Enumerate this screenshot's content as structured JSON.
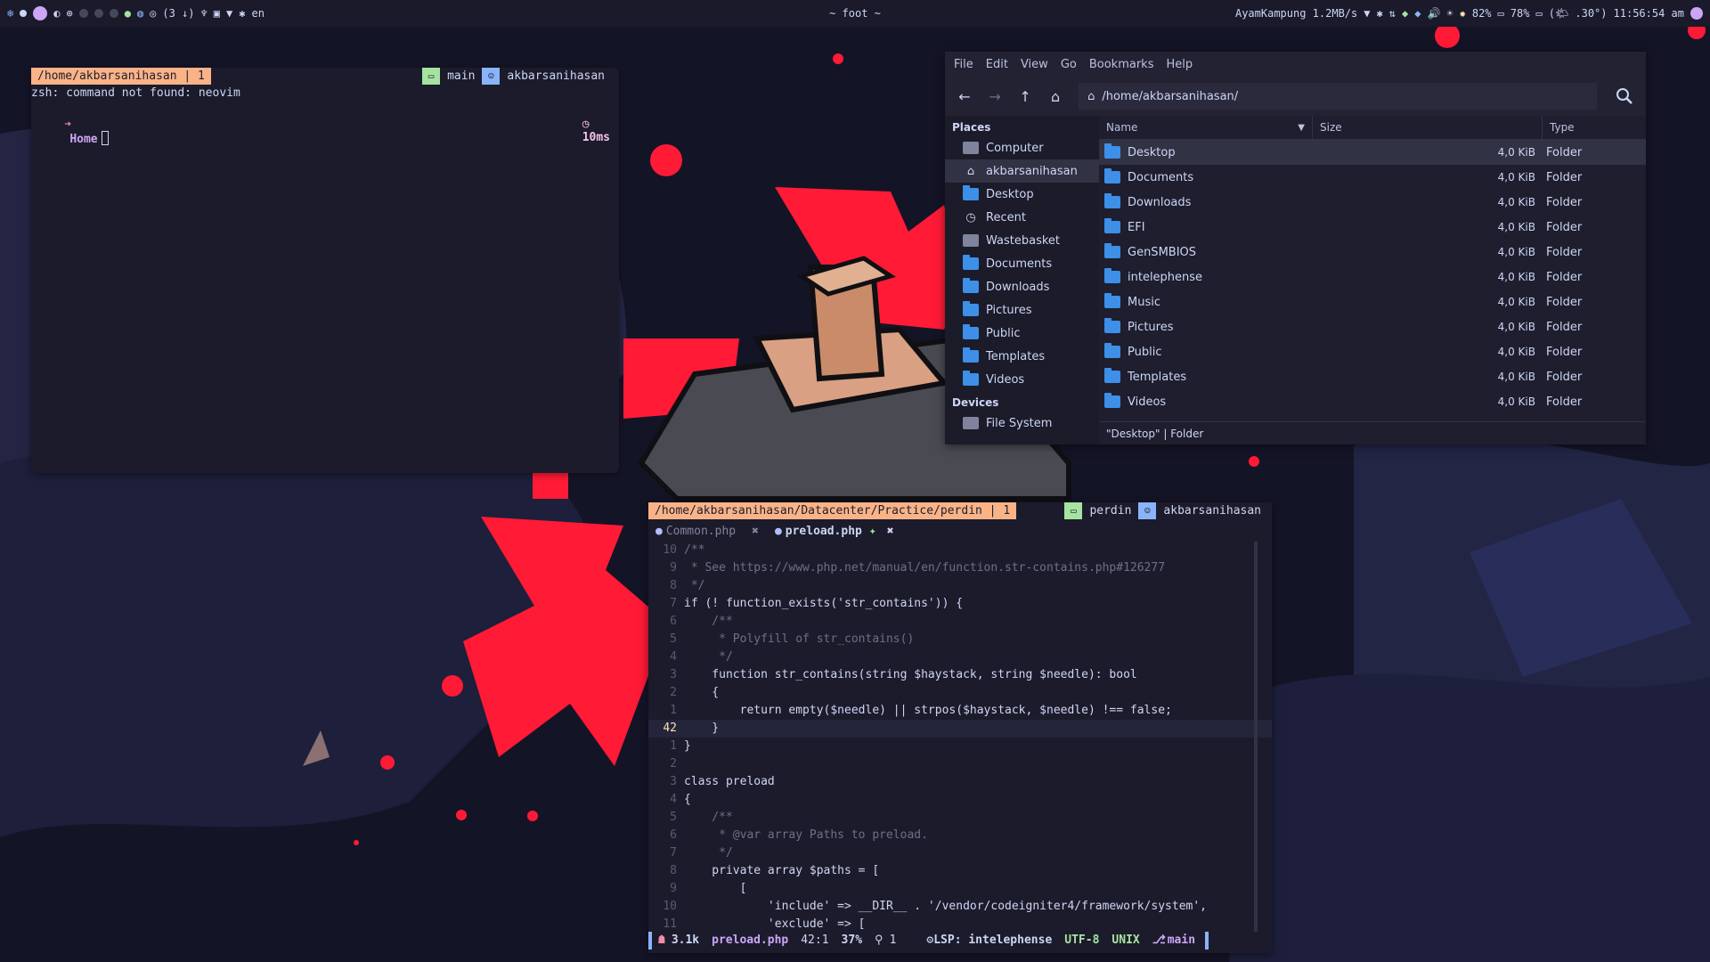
{
  "topbar": {
    "keyboard_layout": "en",
    "window_title": "~ foot ~",
    "network": "AyamKampung 1.2MB/s",
    "battery1": "82%",
    "battery2": "78%",
    "weather": "(🌤 .30°)",
    "clock": "11:56:54 am",
    "workspace_counter": "(3 ↓)"
  },
  "terminal1": {
    "path": "/home/akbarsanihasan | 1",
    "branch": "main",
    "user": "akbarsanihasan",
    "error_line": "zsh: command not found: neovim",
    "prompt_dir": "Home",
    "timing": "10ms"
  },
  "filemanager": {
    "menu": [
      "File",
      "Edit",
      "View",
      "Go",
      "Bookmarks",
      "Help"
    ],
    "location": "/home/akbarsanihasan/",
    "places_header": "Places",
    "devices_header": "Devices",
    "places": [
      {
        "label": "Computer",
        "icon": "computer-icon"
      },
      {
        "label": "akbarsanihasan",
        "icon": "home-icon"
      },
      {
        "label": "Desktop",
        "icon": "folder-icon"
      },
      {
        "label": "Recent",
        "icon": "clock-icon"
      },
      {
        "label": "Wastebasket",
        "icon": "trash-icon"
      },
      {
        "label": "Documents",
        "icon": "folder-icon"
      },
      {
        "label": "Downloads",
        "icon": "folder-icon"
      },
      {
        "label": "Pictures",
        "icon": "folder-icon"
      },
      {
        "label": "Public",
        "icon": "folder-icon"
      },
      {
        "label": "Templates",
        "icon": "folder-icon"
      },
      {
        "label": "Videos",
        "icon": "folder-icon"
      }
    ],
    "devices": [
      {
        "label": "File System",
        "icon": "disk-icon"
      }
    ],
    "columns": {
      "name": "Name",
      "size": "Size",
      "type": "Type"
    },
    "files": [
      {
        "name": "Desktop",
        "size": "4,0 KiB",
        "type": "Folder"
      },
      {
        "name": "Documents",
        "size": "4,0 KiB",
        "type": "Folder"
      },
      {
        "name": "Downloads",
        "size": "4,0 KiB",
        "type": "Folder"
      },
      {
        "name": "EFI",
        "size": "4,0 KiB",
        "type": "Folder"
      },
      {
        "name": "GenSMBIOS",
        "size": "4,0 KiB",
        "type": "Folder"
      },
      {
        "name": "intelephense",
        "size": "4,0 KiB",
        "type": "Folder"
      },
      {
        "name": "Music",
        "size": "4,0 KiB",
        "type": "Folder"
      },
      {
        "name": "Pictures",
        "size": "4,0 KiB",
        "type": "Folder"
      },
      {
        "name": "Public",
        "size": "4,0 KiB",
        "type": "Folder"
      },
      {
        "name": "Templates",
        "size": "4,0 KiB",
        "type": "Folder"
      },
      {
        "name": "Videos",
        "size": "4,0 KiB",
        "type": "Folder"
      }
    ],
    "status": "\"Desktop\" | Folder"
  },
  "editor": {
    "path": "/home/akbarsanihasan/Datacenter/Practice/perdin | 1",
    "branch": "perdin",
    "user": "akbarsanihasan",
    "tabs": [
      {
        "label": "Common.php",
        "active": false
      },
      {
        "label": "preload.php",
        "active": true
      }
    ],
    "lines": [
      {
        "n": "10",
        "text": "/**",
        "cls": "c-com"
      },
      {
        "n": "9",
        "text": " * See https://www.php.net/manual/en/function.str-contains.php#126277",
        "cls": "c-com"
      },
      {
        "n": "8",
        "text": " */",
        "cls": "c-com"
      },
      {
        "n": "7",
        "text": "if (! function_exists('str_contains')) {",
        "cls": "ct"
      },
      {
        "n": "6",
        "text": "    /**",
        "cls": "c-com"
      },
      {
        "n": "5",
        "text": "     * Polyfill of str_contains()",
        "cls": "c-com"
      },
      {
        "n": "4",
        "text": "     */",
        "cls": "c-com"
      },
      {
        "n": "3",
        "text": "    function str_contains(string $haystack, string $needle): bool",
        "cls": "ct"
      },
      {
        "n": "2",
        "text": "    {",
        "cls": "ct"
      },
      {
        "n": "1",
        "text": "        return empty($needle) || strpos($haystack, $needle) !== false;",
        "cls": "ct"
      },
      {
        "n": "42",
        "text": "    }",
        "cls": "ct",
        "current": true
      },
      {
        "n": "1",
        "text": "}",
        "cls": "ct"
      },
      {
        "n": "2",
        "text": "",
        "cls": "ct"
      },
      {
        "n": "3",
        "text": "class preload",
        "cls": "ct"
      },
      {
        "n": "4",
        "text": "{",
        "cls": "ct"
      },
      {
        "n": "5",
        "text": "    /**",
        "cls": "c-com"
      },
      {
        "n": "6",
        "text": "     * @var array Paths to preload.",
        "cls": "c-com"
      },
      {
        "n": "7",
        "text": "     */",
        "cls": "c-com"
      },
      {
        "n": "8",
        "text": "    private array $paths = [",
        "cls": "ct"
      },
      {
        "n": "9",
        "text": "        [",
        "cls": "ct"
      },
      {
        "n": "10",
        "text": "            'include' => __DIR__ . '/vendor/codeigniter4/framework/system',",
        "cls": "ct"
      },
      {
        "n": "11",
        "text": "            'exclude' => [",
        "cls": "ct"
      }
    ],
    "statusline": {
      "size": "3.1k",
      "file": "preload.php",
      "position": "42:1",
      "percent": "37%",
      "diagnostics": "1",
      "lsp": "LSP: intelephense",
      "encoding": "UTF-8",
      "format": "UNIX",
      "branch": "main"
    }
  }
}
